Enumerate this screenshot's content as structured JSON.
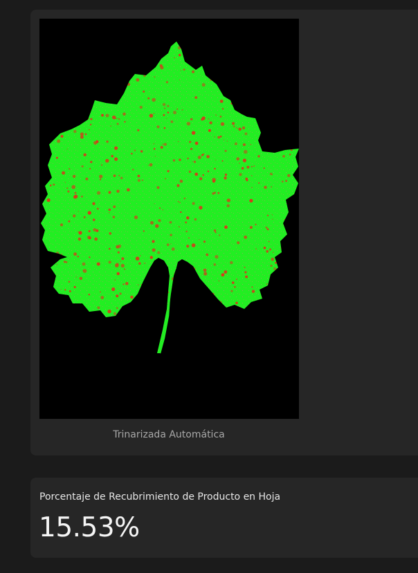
{
  "image_card": {
    "image_description_icon": "leaf-image",
    "caption": "Trinarizada Automática",
    "colors": {
      "background": "#000000",
      "healthy_leaf": "#22ee22",
      "product_coverage": "#d63a1a"
    }
  },
  "metric_card": {
    "label": "Porcentaje de Recubrimiento de Producto en Hoja",
    "value": "15.53%"
  },
  "theme": {
    "page_bg": "#1b1b1b",
    "card_bg": "#262626"
  }
}
